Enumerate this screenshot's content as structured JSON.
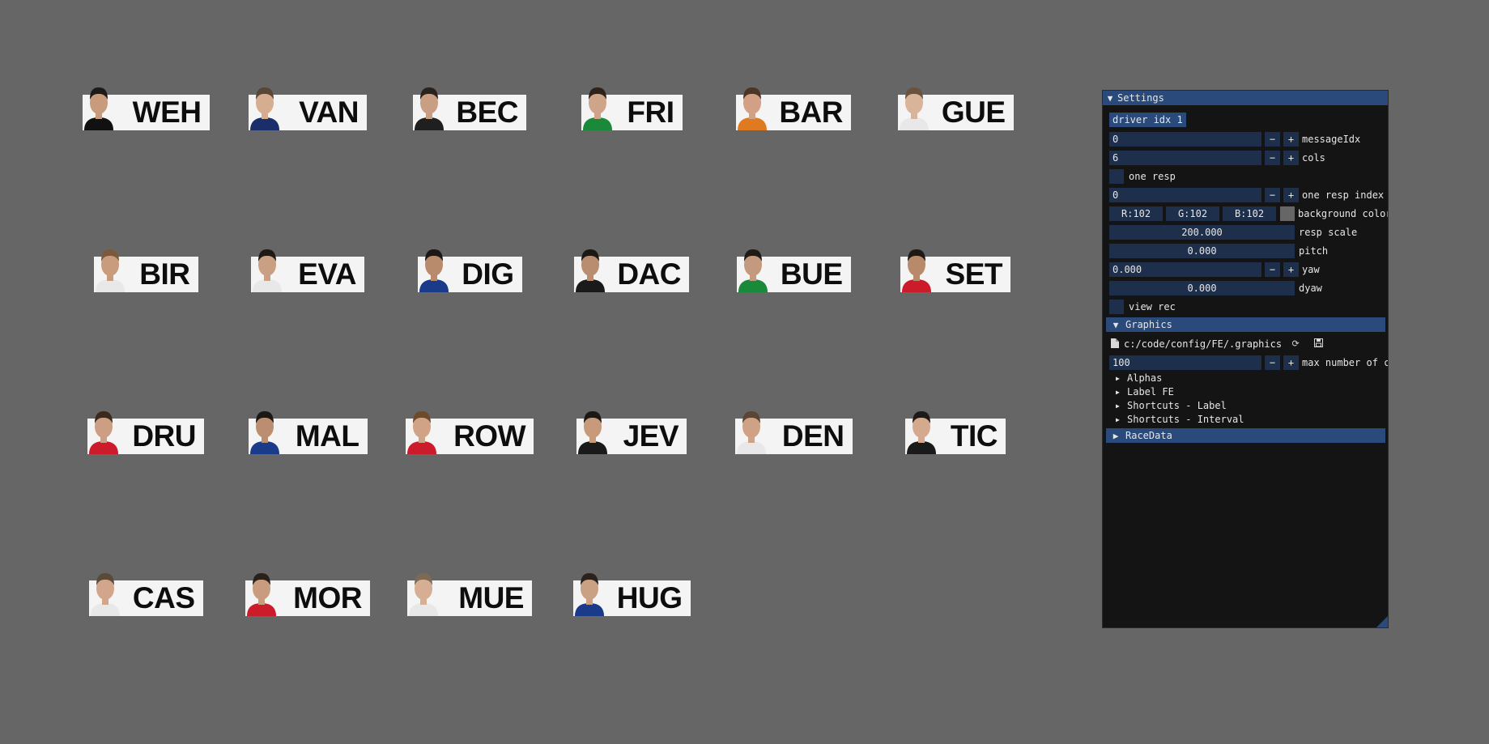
{
  "drivers": [
    "WEH",
    "VAN",
    "BEC",
    "FRI",
    "BAR",
    "GUE",
    "BIR",
    "EVA",
    "DIG",
    "DAC",
    "BUE",
    "SET",
    "DRU",
    "MAL",
    "ROW",
    "JEV",
    "DEN",
    "TIC",
    "CAS",
    "MOR",
    "MUE",
    "HUG"
  ],
  "colors": {
    "background": "#666666",
    "panel": "#141414",
    "header": "#294a7a",
    "frame": "#1d2f4a"
  },
  "settings": {
    "title": "Settings",
    "driver_idx_button": "driver idx 1",
    "message_idx": {
      "value": "0",
      "label": "messageIdx"
    },
    "cols": {
      "value": "6",
      "label": "cols"
    },
    "one_resp": {
      "label": "one resp"
    },
    "one_resp_index": {
      "value": "0",
      "label": "one resp index"
    },
    "background_color": {
      "r": "R:102",
      "g": "G:102",
      "b": "B:102",
      "label": "background color"
    },
    "resp_scale": {
      "value": "200.000",
      "label": "resp scale"
    },
    "pitch": {
      "value": "0.000",
      "label": "pitch"
    },
    "yaw": {
      "value": "0.000",
      "label": "yaw"
    },
    "dyaw": {
      "value": "0.000",
      "label": "dyaw"
    },
    "view_rec": {
      "label": "view rec"
    },
    "minus": "−",
    "plus": "+"
  },
  "graphics": {
    "title": "Graphics",
    "path": "c:/code/config/FE/.graphics",
    "max_cars": {
      "value": "100",
      "label": "max number of cars"
    },
    "items": [
      "Alphas",
      "Label FE",
      "Shortcuts - Label",
      "Shortcuts - Interval"
    ]
  },
  "racedata": {
    "title": "RaceData"
  },
  "icons": {
    "file": "file-icon",
    "reload": "reload-icon",
    "save": "save-icon"
  }
}
